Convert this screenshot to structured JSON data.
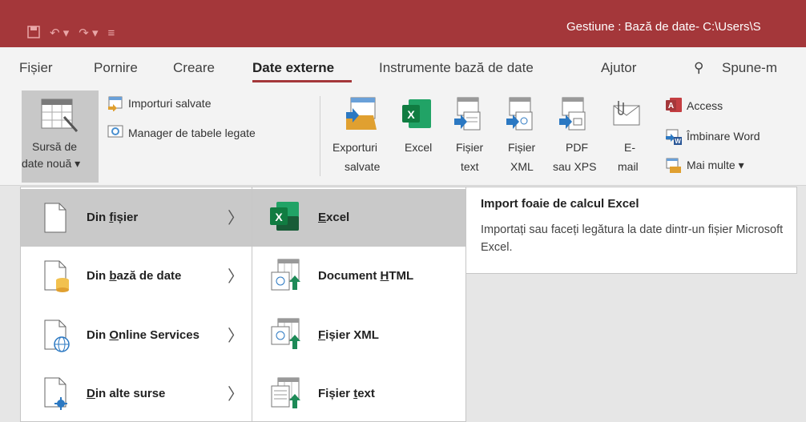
{
  "title": "Gestiune : Bază de date- C:\\Users\\S",
  "tabs": {
    "fisier": "Fișier",
    "pornire": "Pornire",
    "creare": "Creare",
    "date_externe": "Date externe",
    "instrumente": "Instrumente bază de date",
    "ajutor": "Ajutor",
    "search": "Spune-m"
  },
  "ribbon": {
    "sursa_line1": "Sursă de",
    "sursa_line2": "date nouă",
    "importuri": "Importuri salvate",
    "manager": "Manager de tabele legate",
    "exporturi_l1": "Exporturi",
    "exporturi_l2": "salvate",
    "excel": "Excel",
    "fisier_text_l1": "Fișier",
    "fisier_text_l2": "text",
    "fisier_xml_l1": "Fișier",
    "fisier_xml_l2": "XML",
    "pdf_l1": "PDF",
    "pdf_l2": "sau XPS",
    "email_l1": "E-",
    "email_l2": "mail",
    "access": "Access",
    "imbinare": "Îmbinare Word",
    "mai_multe": "Mai multe"
  },
  "menu1": {
    "item1_a": "Din ",
    "item1_b": "f",
    "item1_c": "ișier",
    "item2_a": "Din ",
    "item2_b": "b",
    "item2_c": "ază de date",
    "item3_a": "Din ",
    "item3_b": "O",
    "item3_c": "nline Services",
    "item4_a": "D",
    "item4_b": "in alte surse",
    "chevron": "〉"
  },
  "menu2": {
    "excel_a": "E",
    "excel_b": "xcel",
    "html_a": "Document ",
    "html_b": "H",
    "html_c": "TML",
    "xml_a": "F",
    "xml_b": "ișier XML",
    "text_a": "Fișier ",
    "text_b": "t",
    "text_c": "ext"
  },
  "tooltip": {
    "title": "Import foaie de calcul Excel",
    "desc": "Importați sau faceți legătura la date dintr-un fișier Microsoft Excel."
  },
  "colors": {
    "titlebar": "#a4373a",
    "excel_green": "#1d6f42",
    "access_red": "#a4373a"
  }
}
